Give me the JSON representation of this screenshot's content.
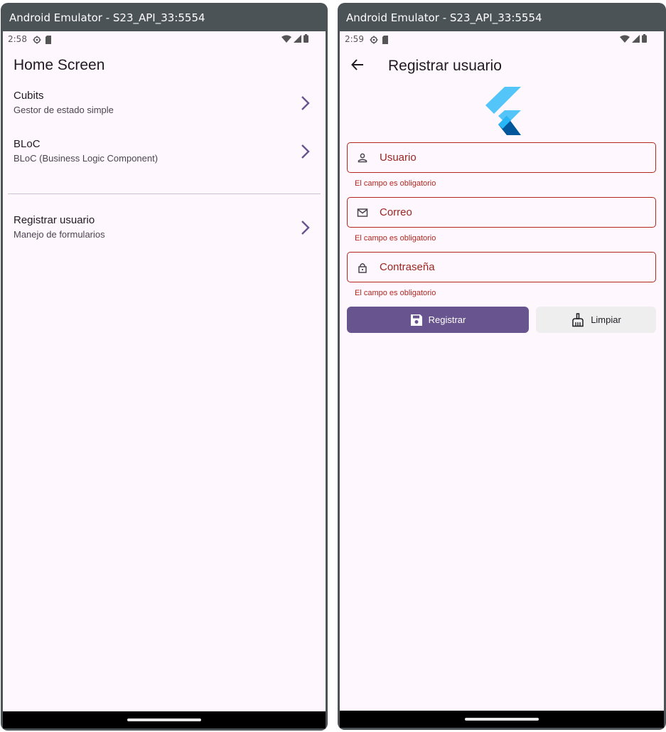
{
  "left_window": {
    "title": "Android Emulator - S23_API_33:5554",
    "status": {
      "time": "2:58"
    },
    "screen": {
      "title": "Home Screen",
      "items": [
        {
          "title": "Cubits",
          "subtitle": "Gestor de estado simple"
        },
        {
          "title": "BLoC",
          "subtitle": "BLoC (Business Logic Component)"
        },
        {
          "title": "Registrar usuario",
          "subtitle": "Manejo de formularios"
        }
      ]
    }
  },
  "right_window": {
    "title": "Android Emulator - S23_API_33:5554",
    "status": {
      "time": "2:59"
    },
    "screen": {
      "title": "Registrar usuario",
      "fields": [
        {
          "label": "Usuario",
          "icon": "person-icon",
          "error": "El campo es obligatorio",
          "value": ""
        },
        {
          "label": "Correo",
          "icon": "mail-icon",
          "error": "El campo es obligatorio",
          "value": ""
        },
        {
          "label": "Contraseña",
          "icon": "lock-icon",
          "error": "El campo es obligatorio",
          "value": ""
        }
      ],
      "buttons": {
        "primary": {
          "label": "Registrar",
          "icon": "save-icon"
        },
        "secondary": {
          "label": "Limpiar",
          "icon": "broom-icon"
        }
      }
    }
  },
  "colors": {
    "background": "#fef7fe",
    "accent": "#68548e",
    "error": "#b3261e",
    "emulator_frame": "#4b5357"
  }
}
